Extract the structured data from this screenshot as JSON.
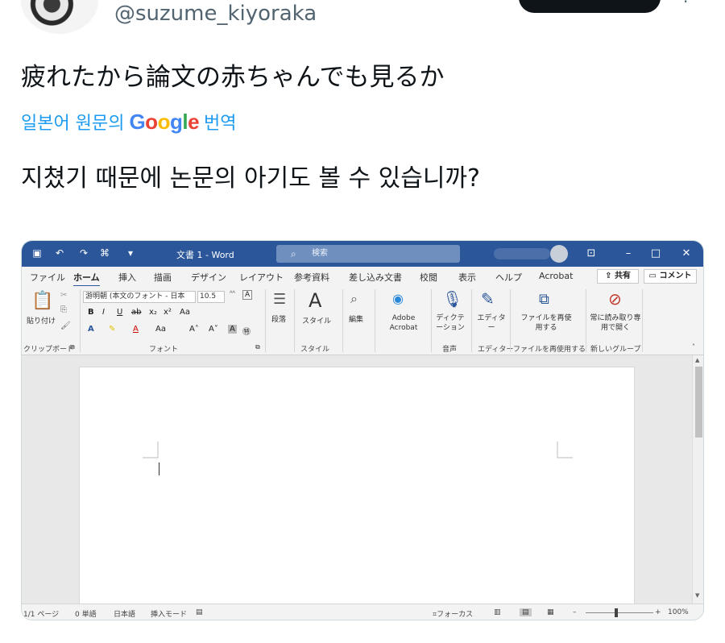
{
  "tweet": {
    "handle": "@suzume_kiyoraka",
    "text": "疲れたから論文の赤ちゃんでも見るか",
    "translate_prefix": "일본어 원문의",
    "translate_brand": "Google",
    "translate_suffix": "번역",
    "translated_text": "지쳤기 때문에 논문의 아기도 볼 수 있습니까?"
  },
  "word": {
    "title": "文書 1 - Word",
    "search_placeholder": "検索",
    "tabs": [
      "ファイル",
      "ホーム",
      "挿入",
      "描画",
      "デザイン",
      "レイアウト",
      "参考資料",
      "差し込み文書",
      "校閲",
      "表示",
      "ヘルプ",
      "Acrobat"
    ],
    "share_label": "共有",
    "comment_label": "コメント",
    "ribbon": {
      "paste_label": "貼り付け",
      "font_name": "游明朝 (本文のフォント - 日本",
      "font_size": "10.5",
      "paragraph_label": "段落",
      "style_label": "スタイル",
      "edit_label": "編集",
      "adobe_label": "Adobe Acrobat",
      "dictate_label": "ディクテーション",
      "editor_label": "エディター",
      "reuse_label": "ファイルを再使用する",
      "readonly_label": "常に読み取り専用で開く",
      "groups": {
        "clipboard": "クリップボード",
        "font": "フォント",
        "style": "スタイル",
        "voice": "音声",
        "editor": "エディター",
        "reuse": "ファイルを再使用する",
        "newgroup": "新しいグループ"
      }
    },
    "status": {
      "page": "1/1 ページ",
      "words": "0 単語",
      "language": "日本語",
      "mode": "挿入モード",
      "focus": "フォーカス",
      "zoom": "100%"
    }
  }
}
